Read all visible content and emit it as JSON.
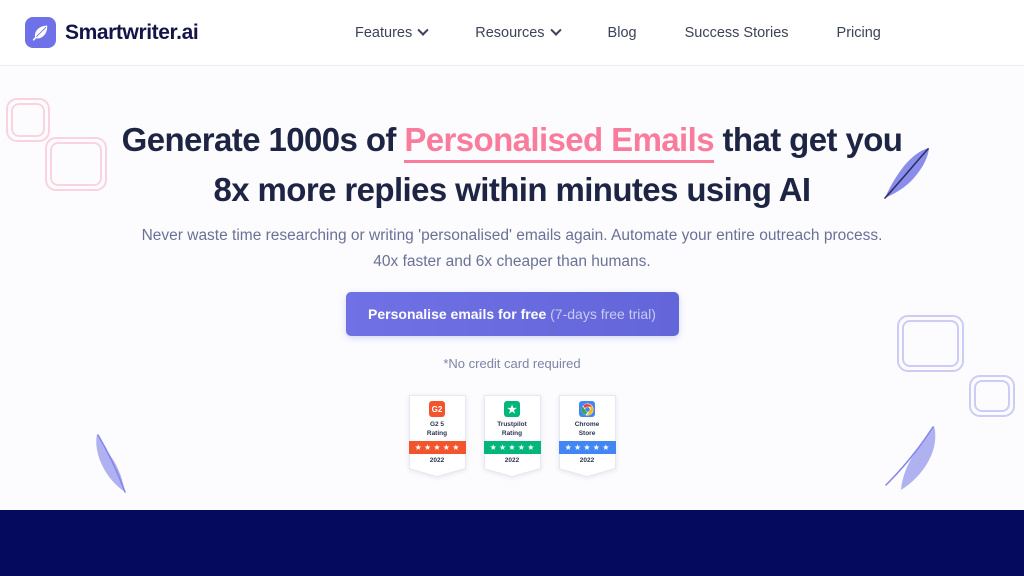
{
  "brand": {
    "name": "Smartwriter.ai",
    "icon": "feather-quill-icon",
    "mark_color": "#6f71e8",
    "text_color": "#141449"
  },
  "nav": {
    "items": [
      {
        "label": "Features",
        "has_dropdown": true
      },
      {
        "label": "Resources",
        "has_dropdown": true
      },
      {
        "label": "Blog",
        "has_dropdown": false
      },
      {
        "label": "Success Stories",
        "has_dropdown": false
      },
      {
        "label": "Pricing",
        "has_dropdown": false
      }
    ]
  },
  "hero": {
    "headline_part1": "Generate 1000s of ",
    "headline_highlight": "Personalised Emails",
    "headline_part2": " that get you 8x more replies within minutes using AI",
    "highlight_color": "#fa7c9c",
    "subheadline": "Never waste time researching or writing 'personalised' emails again. Automate your entire outreach process. 40x faster and 6x cheaper than humans.",
    "cta_label": "Personalise emails for free",
    "cta_note": "(7-days free trial)",
    "cta_color": "#6b6ee0",
    "disclaimer": "*No credit card required"
  },
  "badges": [
    {
      "logo": "g2-icon",
      "logo_text": "G2",
      "logo_color": "#f2552c",
      "title": "G2 5\nRating",
      "stars": "★ ★ ★ ★ ★",
      "band_color": "#f2552c",
      "year": "2022"
    },
    {
      "logo": "trustpilot-star-icon",
      "logo_text": "★",
      "logo_color": "#00b67a",
      "title": "Trustpilot\nRating",
      "stars": "★ ★ ★ ★ ★",
      "band_color": "#00b67a",
      "year": "2022"
    },
    {
      "logo": "chrome-store-icon",
      "logo_text": "",
      "logo_color": "#4285f4",
      "title": "Chrome\nStore",
      "stars": "★ ★ ★ ★ ★",
      "band_color": "#4285f4",
      "year": "2022"
    }
  ],
  "decorations": {
    "square_pink": "#fbd3de",
    "square_purple": "#ccccf6",
    "feather_purple": "#7b7de8",
    "feather_light": "#a6a8ef"
  },
  "footer_band": {
    "color": "#050a5e"
  }
}
